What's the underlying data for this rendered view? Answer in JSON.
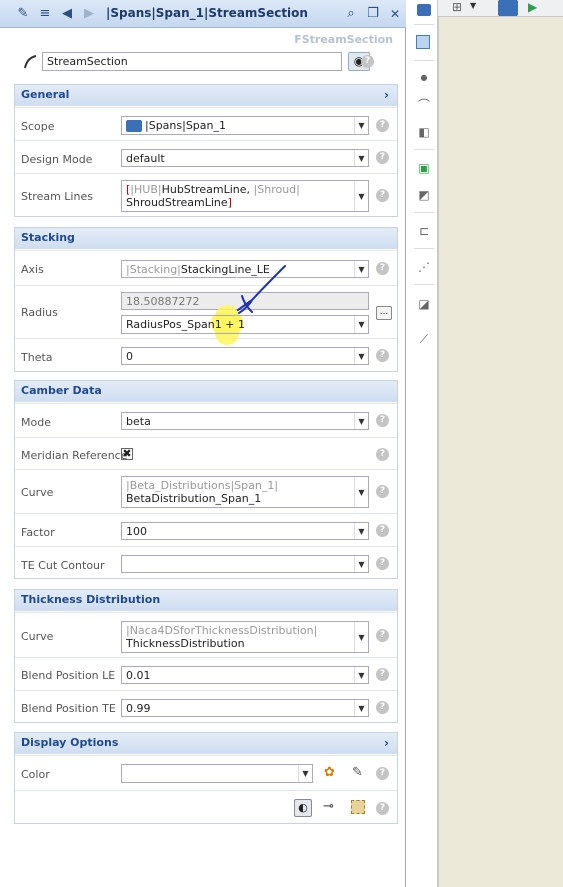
{
  "title": "|Spans|Span_1|StreamSection",
  "panel_type": "FStreamSection",
  "name_value": "StreamSection",
  "general": {
    "header": "General",
    "scope_label": "Scope",
    "scope_value": "|Spans|Span_1",
    "design_mode_label": "Design Mode",
    "design_mode_value": "default",
    "stream_lines_label": "Stream Lines",
    "stream_lines_bracket_open": "[",
    "stream_lines_hub_ref": "|HUB|",
    "stream_lines_hub_name": "HubStreamLine, ",
    "stream_lines_shroud_ref": "|Shroud|",
    "stream_lines_shroud_name": "ShroudStreamLine",
    "stream_lines_bracket_close": "]"
  },
  "stacking": {
    "header": "Stacking",
    "axis_label": "Axis",
    "axis_ref": "|Stacking|",
    "axis_name": "StackingLine_LE",
    "radius_label": "Radius",
    "radius_value": "18.50887272",
    "radius_expr": "RadiusPos_Span1 + 1",
    "theta_label": "Theta",
    "theta_value": "0",
    "dots_label": "..."
  },
  "camber": {
    "header": "Camber Data",
    "mode_label": "Mode",
    "mode_value": "beta",
    "meridian_label": "Meridian Reference",
    "meridian_checked": "✖",
    "curve_label": "Curve",
    "curve_ref": "|Beta_Distributions|Span_1|",
    "curve_name": "BetaDistribution_Span_1",
    "factor_label": "Factor",
    "factor_value": "100",
    "te_cut_label": "TE Cut Contour",
    "te_cut_value": ""
  },
  "thickness": {
    "header": "Thickness Distribution",
    "curve_label": "Curve",
    "curve_ref": "|Naca4DSforThicknessDistribution|",
    "curve_name": "ThicknessDistribution",
    "blend_le_label": "Blend Position LE",
    "blend_le_value": "0.01",
    "blend_te_label": "Blend Position TE",
    "blend_te_value": "0.99"
  },
  "display": {
    "header": "Display Options",
    "color_label": "Color",
    "color_value": ""
  },
  "help_glyph": "?",
  "dropdown_glyph": "▼",
  "chevron_glyph": "›"
}
